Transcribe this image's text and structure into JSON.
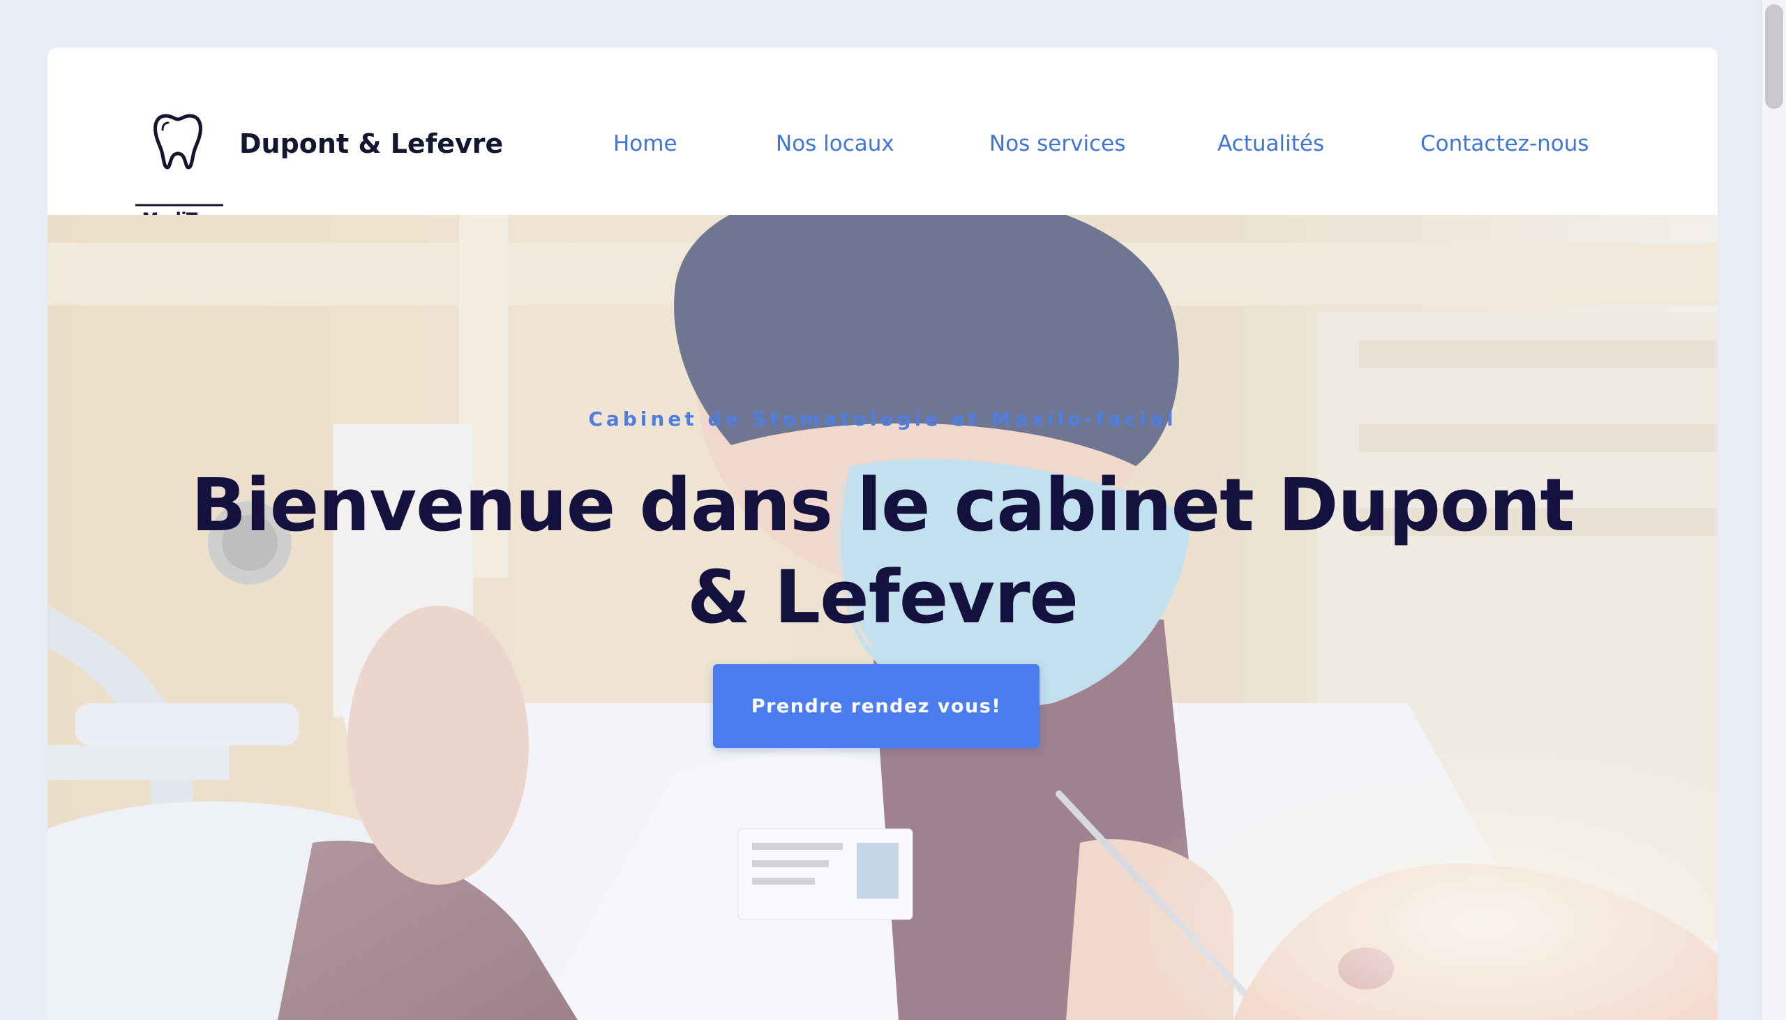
{
  "header": {
    "logo_text": "MediTex",
    "brand": "Dupont & Lefevre"
  },
  "nav": {
    "items": [
      {
        "label": "Home"
      },
      {
        "label": "Nos locaux"
      },
      {
        "label": "Nos services"
      },
      {
        "label": "Actualités"
      },
      {
        "label": "Contactez-nous"
      }
    ]
  },
  "hero": {
    "kicker": "Cabinet de Stomatologie et Maxilo-facial",
    "title": "Bienvenue dans le cabinet Dupont & Lefevre",
    "cta_label": "Prendre rendez vous!"
  },
  "colors": {
    "page_background": "#e7ecf7",
    "nav_link": "#3f74d8",
    "title": "#14113f",
    "kicker": "#4f7ee0",
    "cta_background": "#4a7df0"
  }
}
